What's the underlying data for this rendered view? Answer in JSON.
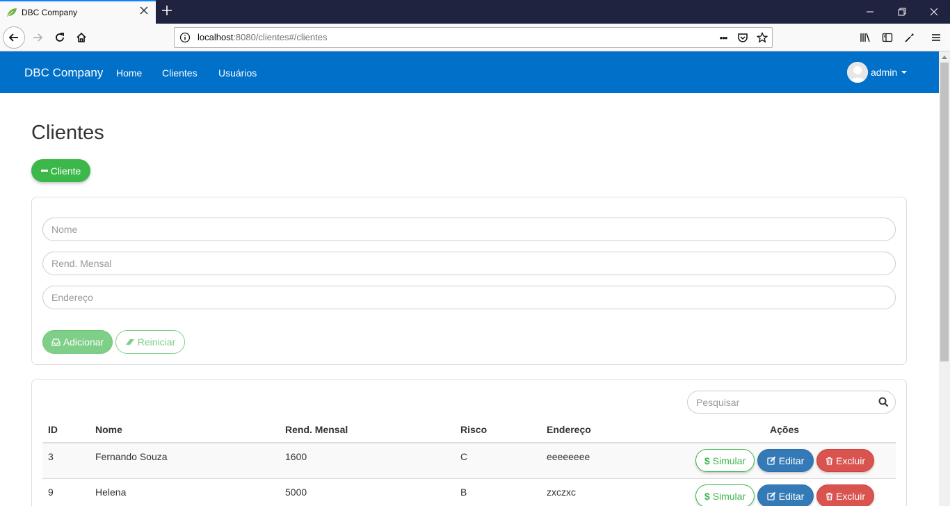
{
  "browser": {
    "tab_title": "DBC Company",
    "url_host": "localhost",
    "url_rest": ":8080/clientes#/clientes",
    "url_more": "•••"
  },
  "navbar": {
    "brand": "DBC Company",
    "links": [
      "Home",
      "Clientes",
      "Usuários"
    ],
    "user": "admin"
  },
  "page": {
    "title": "Clientes",
    "toggle_label": "Cliente"
  },
  "form": {
    "nome_placeholder": "Nome",
    "renda_placeholder": "Rend. Mensal",
    "endereco_placeholder": "Endereço",
    "add_label": "Adicionar",
    "reset_label": "Reiniciar"
  },
  "table": {
    "search_placeholder": "Pesquisar",
    "headers": [
      "ID",
      "Nome",
      "Rend. Mensal",
      "Risco",
      "Endereço",
      "Ações"
    ],
    "rows": [
      {
        "id": "3",
        "nome": "Fernando Souza",
        "renda": "1600",
        "risco": "C",
        "endereco": "eeeeeeee"
      },
      {
        "id": "9",
        "nome": "Helena",
        "renda": "5000",
        "risco": "B",
        "endereco": "zxczxc"
      }
    ],
    "actions": {
      "simular": "Simular",
      "editar": "Editar",
      "excluir": "Excluir"
    }
  },
  "colors": {
    "navbar": "#0070c9",
    "success": "#3cb84a",
    "primary": "#337ab7",
    "danger": "#d9534f"
  }
}
